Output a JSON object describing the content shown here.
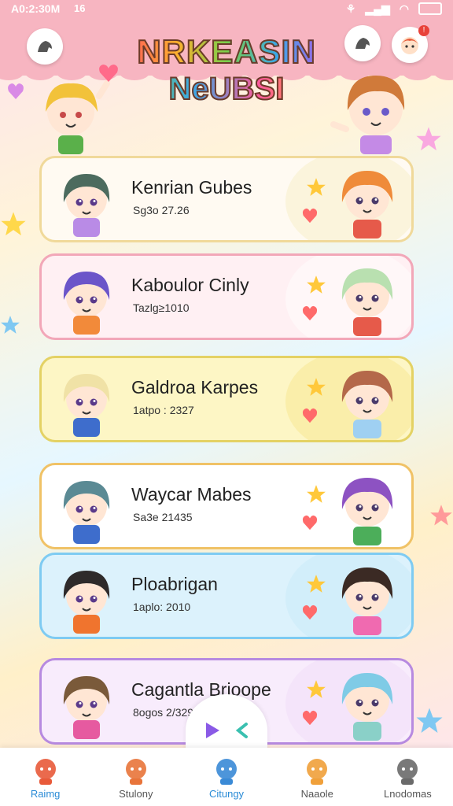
{
  "status_bar": {
    "time": "A0:2:30M",
    "app_badge": "16"
  },
  "header": {
    "title_line1": "NRKEASIN",
    "title_line2": "NeUBSI",
    "left_button_icon": "bird-icon",
    "middle_button_icon": "bird-icon",
    "right_button_icon": "avatar-icon",
    "notification_badge": "!"
  },
  "cards": [
    {
      "name": "Kenrian Gubes",
      "sub": "Sg3o 27.26",
      "border": "#f0d99a",
      "bg": "#fffaf2",
      "blob": "#f6eec0",
      "left_hair": "#4c6b5e",
      "left_shirt": "#b98be6",
      "right_hair": "#ef8b3a",
      "right_shirt": "#e65a4a"
    },
    {
      "name": "Kaboulor Cinly",
      "sub": "Tazlg≥1010",
      "border": "#f2a7b8",
      "bg": "#fff0f3",
      "blob": "#ffffff",
      "left_hair": "#6b55c9",
      "left_shirt": "#f28a3a",
      "right_hair": "#b9e0b0",
      "right_shirt": "#e65a4a"
    },
    {
      "name": "Galdroa Karpes",
      "sub": "1atpo : 2327",
      "border": "#e4d264",
      "bg": "#fdf6c5",
      "blob": "#f7e48a",
      "left_hair": "#f0e2a6",
      "left_shirt": "#3e6dcc",
      "right_hair": "#b4684a",
      "right_shirt": "#9fd0f2"
    },
    {
      "name": "Waycar Mabes",
      "sub": "Sa3e 21435",
      "border": "#f0c266",
      "bg": "#ffffff",
      "blob": "#ffffff",
      "left_hair": "#5b8a94",
      "left_shirt": "#3e6dcc",
      "right_hair": "#8d52c2",
      "right_shirt": "#4cae5a"
    },
    {
      "name": "Ploabrigan",
      "sub": "1aplo: 2010",
      "border": "#7ecbf2",
      "bg": "#dcf2fc",
      "blob": "#c6e8f8",
      "left_hair": "#2e2a2a",
      "left_shirt": "#f0742e",
      "right_hair": "#3b2a24",
      "right_shirt": "#f06ab0"
    },
    {
      "name": "Cagantla Brioope",
      "sub": "8ogos 2/329 12",
      "border": "#b78ae0",
      "bg": "#f8ecfc",
      "blob": "#f0dcf8",
      "left_hair": "#7a5a3a",
      "left_shirt": "#e65aa0",
      "right_hair": "#7fcbe6",
      "right_shirt": "#8ad0c8"
    }
  ],
  "nav": [
    {
      "label": "Raimg",
      "icon": "bell-icon",
      "color": "#e85a3a",
      "active": true
    },
    {
      "label": "Stulony",
      "icon": "bear-icon",
      "color": "#e8743a",
      "active": false
    },
    {
      "label": "Citungy",
      "icon": "character-icon",
      "color": "#3a8ad6",
      "active": true
    },
    {
      "label": "Naaole",
      "icon": "girl-icon",
      "color": "#f0a03a",
      "active": false
    },
    {
      "label": "Lnodomas",
      "icon": "play-tile-icon",
      "color": "#6a6a6a",
      "active": false
    }
  ],
  "play_controls": {
    "play_icon": "play-icon",
    "back_icon": "rewind-icon"
  }
}
